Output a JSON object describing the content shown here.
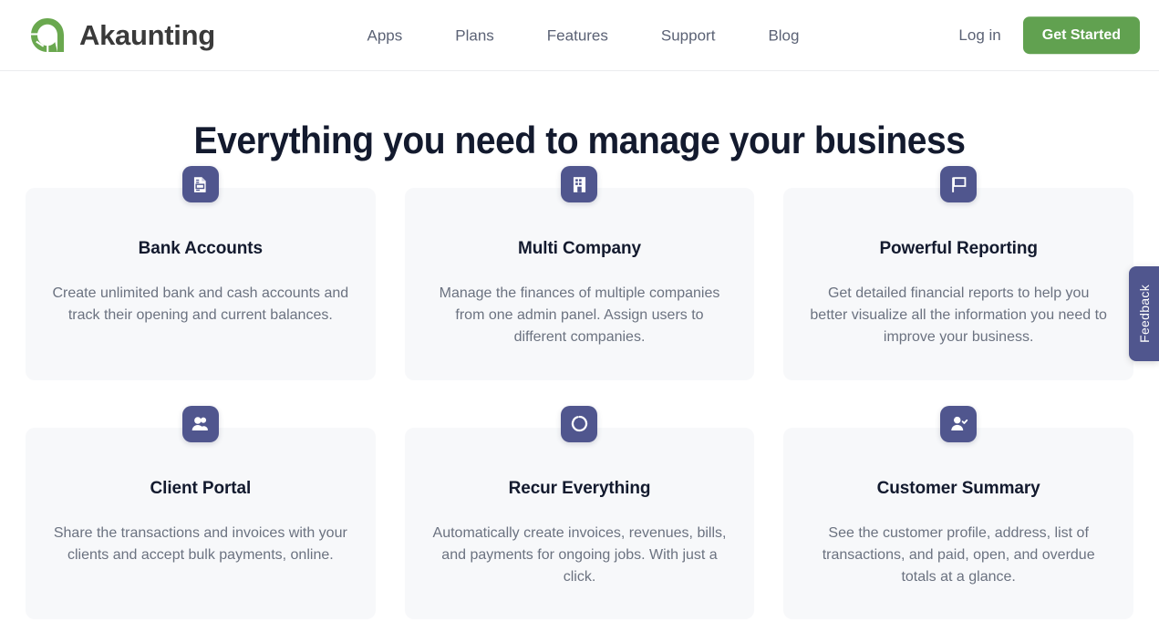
{
  "header": {
    "brand": {
      "name": "Akaunting",
      "logo_icon": "akaunting-donut-logo",
      "logo_color": "#6aa84f"
    },
    "nav": [
      {
        "label": "Apps"
      },
      {
        "label": "Plans"
      },
      {
        "label": "Features"
      },
      {
        "label": "Support"
      },
      {
        "label": "Blog"
      }
    ],
    "login_label": "Log in",
    "cta_label": "Get Started",
    "cta_color": "#61a150"
  },
  "main": {
    "section_title": "Everything you need to manage your business",
    "cards": [
      {
        "title": "Bank Accounts",
        "text": "Create unlimited bank and cash accounts and track their opening and current balances.",
        "icon": "document-invoice-icon"
      },
      {
        "title": "Multi Company",
        "text": "Manage the finances of multiple companies from one admin panel. Assign users to different companies.",
        "icon": "building-icon"
      },
      {
        "title": "Powerful Reporting",
        "text": "Get detailed financial reports to help you better visualize all the information you need to improve your business.",
        "icon": "flag-icon"
      },
      {
        "title": "Client Portal",
        "text": "Share the transactions and invoices with your clients and accept bulk payments, online.",
        "icon": "people-group-icon"
      },
      {
        "title": "Recur Everything",
        "text": "Automatically create invoices, revenues, bills, and payments for ongoing jobs. With just a click.",
        "icon": "circle-loop-icon"
      },
      {
        "title": "Customer Summary",
        "text": "See the customer profile, address, list of transactions, and paid, open, and overdue totals at a glance.",
        "icon": "person-check-icon"
      }
    ],
    "icon_tile_color": "#50568e",
    "card_background": "#f7f8fa"
  },
  "feedback": {
    "label": "Feedback",
    "color": "#50568e"
  }
}
